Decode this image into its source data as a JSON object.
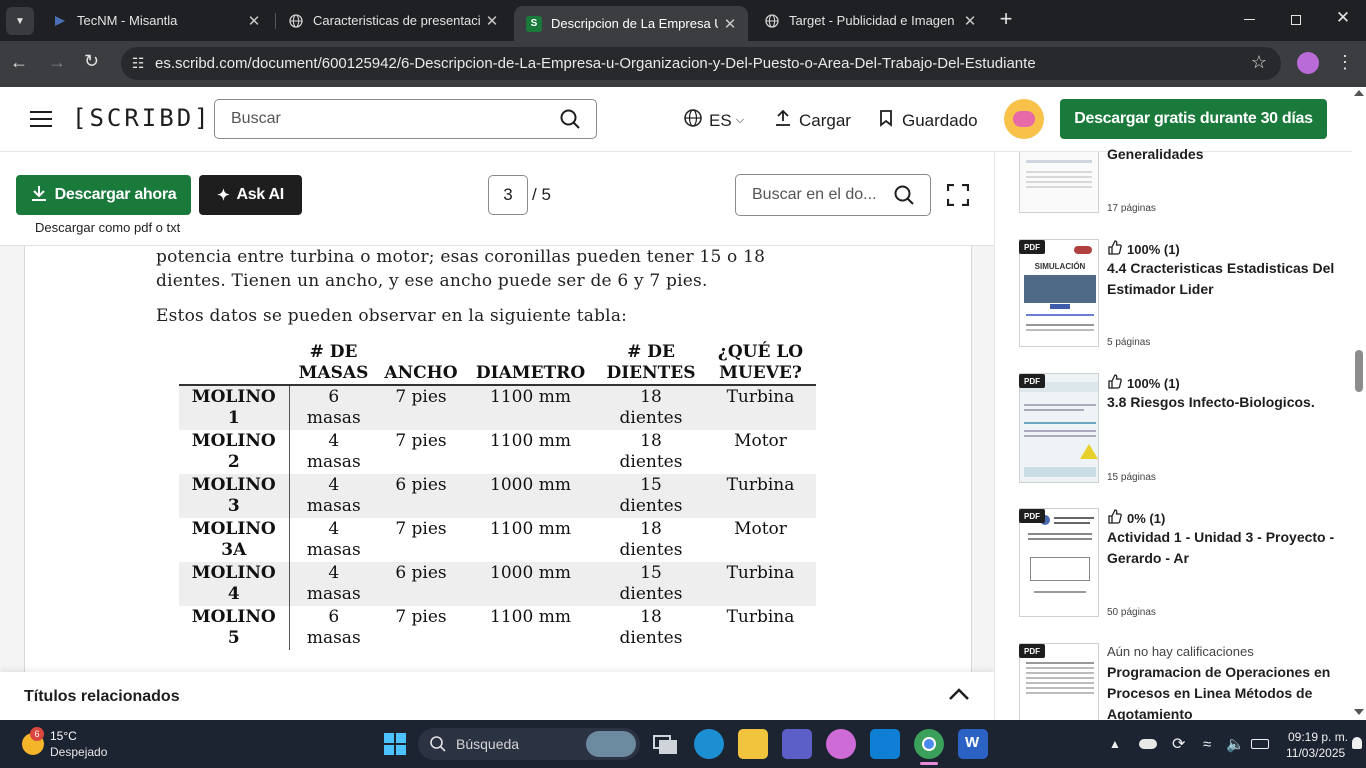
{
  "browser": {
    "tabs": [
      {
        "label": "TecNM - Misantla",
        "active": false
      },
      {
        "label": "Caracteristicas de presentacion",
        "active": false
      },
      {
        "label": "Descripcion de La Empresa U O",
        "active": true
      },
      {
        "label": "Target - Publicidad e Imagen",
        "active": false
      }
    ],
    "url": "es.scribd.com/document/600125942/6-Descripcion-de-La-Empresa-u-Organizacion-y-Del-Puesto-o-Area-Del-Trabajo-Del-Estudiante"
  },
  "header": {
    "logo": "[SCRIBD]",
    "search_placeholder": "Buscar",
    "language": "ES",
    "upload": "Cargar",
    "saved": "Guardado",
    "trial_button": "Descargar gratis durante 30 días"
  },
  "doc_toolbar": {
    "download_button": "Descargar ahora",
    "ask_ai_button": "Ask AI",
    "download_note": "Descargar como pdf o txt",
    "page_current": "3",
    "page_total": "/ 5",
    "doc_search_placeholder": "Buscar en el do..."
  },
  "document": {
    "lines": [
      "potencia entre turbina o motor; esas coronillas pueden tener 15 o 18",
      "dientes. Tienen un ancho, y ese ancho puede ser de 6 y 7 pies.",
      "Estos datos se pueden observar en la siguiente tabla:"
    ],
    "table": {
      "headers": [
        {
          "l1": "",
          "l2": ""
        },
        {
          "l1": "# DE",
          "l2": "MASAS"
        },
        {
          "l1": "ANCHO",
          "l2": ""
        },
        {
          "l1": "DIAMETRO",
          "l2": ""
        },
        {
          "l1": "# DE",
          "l2": "DIENTES"
        },
        {
          "l1": "¿QUÉ LO",
          "l2": "MUEVE?"
        }
      ],
      "rows": [
        {
          "name1": "MOLINO",
          "name2": "1",
          "masas1": "6",
          "masas2": "masas",
          "ancho": "7 pies",
          "diametro": "1100 mm",
          "dientes1": "18",
          "dientes2": "dientes",
          "mueve": "Turbina"
        },
        {
          "name1": "MOLINO",
          "name2": "2",
          "masas1": "4",
          "masas2": "masas",
          "ancho": "7 pies",
          "diametro": "1100 mm",
          "dientes1": "18",
          "dientes2": "dientes",
          "mueve": "Motor"
        },
        {
          "name1": "MOLINO",
          "name2": "3",
          "masas1": "4",
          "masas2": "masas",
          "ancho": "6 pies",
          "diametro": "1000 mm",
          "dientes1": "15",
          "dientes2": "dientes",
          "mueve": "Turbina"
        },
        {
          "name1": "MOLINO",
          "name2": "3A",
          "masas1": "4",
          "masas2": "masas",
          "ancho": "7 pies",
          "diametro": "1100 mm",
          "dientes1": "18",
          "dientes2": "dientes",
          "mueve": "Motor"
        },
        {
          "name1": "MOLINO",
          "name2": "4",
          "masas1": "4",
          "masas2": "masas",
          "ancho": "6 pies",
          "diametro": "1000 mm",
          "dientes1": "15",
          "dientes2": "dientes",
          "mueve": "Turbina"
        },
        {
          "name1": "MOLINO",
          "name2": "5",
          "masas1": "6",
          "masas2": "masas",
          "ancho": "7 pies",
          "diametro": "1100 mm",
          "dientes1": "18",
          "dientes2": "dientes",
          "mueve": "Turbina"
        }
      ]
    }
  },
  "related": {
    "title": "Títulos relacionados"
  },
  "sidebar": {
    "items": [
      {
        "rating": "",
        "title": "Generalidades",
        "pages": "17 páginas",
        "badge": ""
      },
      {
        "rating": "100% (1)",
        "title": "4.4 Cracteristicas Estadisticas Del Estimador Lider",
        "pages": "5 páginas",
        "badge": "PDF",
        "thumb_title": "SIMULACIÓN"
      },
      {
        "rating": "100% (1)",
        "title": "3.8 Riesgos Infecto-Biologicos.",
        "pages": "15 páginas",
        "badge": "PDF"
      },
      {
        "rating": "0% (1)",
        "title": "Actividad 1 - Unidad 3 - Proyecto - Gerardo - Ar",
        "pages": "50 páginas",
        "badge": "PDF"
      },
      {
        "rating": "Aún no hay calificaciones",
        "title": "Programacion de Operaciones en Procesos en Linea Métodos de Agotamiento",
        "pages": "",
        "badge": "PDF"
      }
    ]
  },
  "taskbar": {
    "weather_badge": "6",
    "temperature": "15°C",
    "weather_desc": "Despejado",
    "search": "Búsqueda",
    "time": "09:19 p. m.",
    "date": "11/03/2025"
  },
  "colors": {
    "scribd_green": "#1a7a3b",
    "chrome_dark": "#1f2023",
    "taskbar": "#1c2331"
  }
}
